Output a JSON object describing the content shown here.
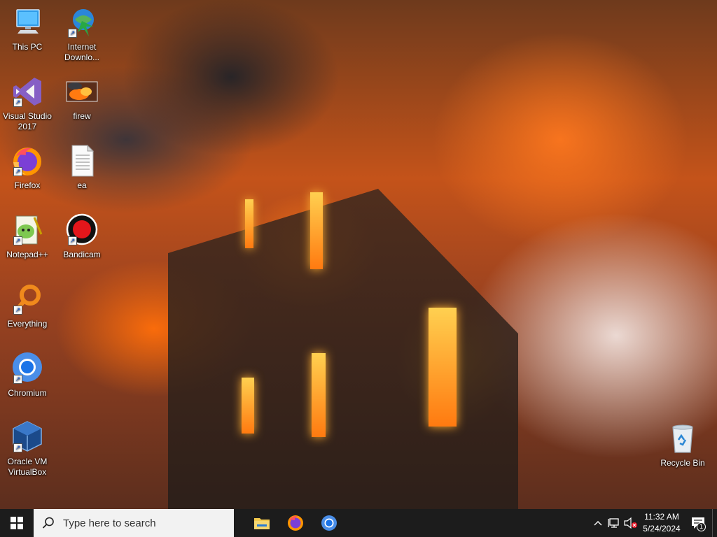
{
  "desktop": {
    "icons": [
      {
        "label": "This PC",
        "icon": "computer-icon"
      },
      {
        "label": "Internet Downlo...",
        "icon": "idm-globe-icon"
      },
      {
        "label": "Visual Studio 2017",
        "icon": "visual-studio-icon"
      },
      {
        "label": "firew",
        "icon": "image-thumbnail-icon"
      },
      {
        "label": "Firefox",
        "icon": "firefox-icon"
      },
      {
        "label": "ea",
        "icon": "text-file-icon"
      },
      {
        "label": "Notepad++",
        "icon": "notepadpp-icon"
      },
      {
        "label": "Bandicam",
        "icon": "bandicam-record-icon"
      },
      {
        "label": "Everything",
        "icon": "everything-search-icon"
      },
      {
        "label": "Chromium",
        "icon": "chromium-icon"
      },
      {
        "label": "Oracle VM VirtualBox",
        "icon": "virtualbox-icon"
      },
      {
        "label": "Recycle Bin",
        "icon": "recycle-bin-icon"
      }
    ]
  },
  "taskbar": {
    "search_placeholder": "Type here to search",
    "pinned": [
      "file-explorer-icon",
      "firefox-icon",
      "chromium-icon"
    ],
    "clock": {
      "time": "11:32 AM",
      "date": "5/24/2024"
    },
    "notification_count": "1"
  },
  "colors": {
    "taskbar_bg": "#1c1c1c",
    "search_bg": "#f2f2f2",
    "accent": "#1a73e8"
  }
}
